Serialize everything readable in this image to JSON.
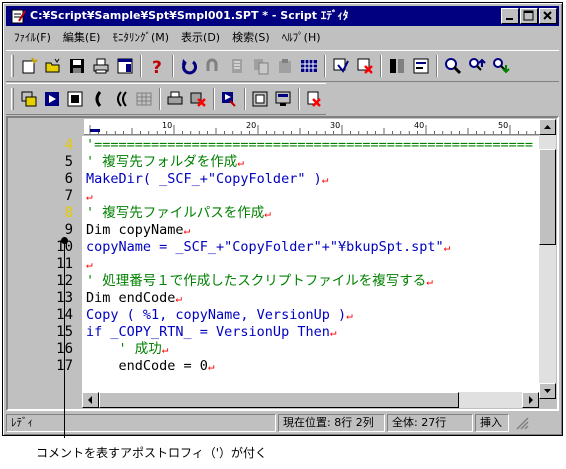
{
  "window": {
    "title": "C:¥Script¥Sample¥Spt¥Smpl001.SPT * - Script ｴﾃﾞｨﾀ"
  },
  "menu": [
    "ﾌｧｲﾙ(F)",
    "編集(E)",
    "ﾓﾆﾀﾘﾝｸﾞ(M)",
    "表示(D)",
    "検索(S)",
    "ﾍﾙﾌﾟ(H)"
  ],
  "toolbar1": [
    "new-file-icon",
    "open-icon",
    "save-icon",
    "print-icon",
    "properties-icon",
    "help-icon",
    "undo-icon",
    "redo-icon",
    "cut-icon",
    "copy-icon",
    "paste-icon",
    "grid-icon",
    "filter-icon",
    "delete-filter-icon",
    "format-icon",
    "settings-icon",
    "find-icon",
    "find-next-icon",
    "find-prev-icon"
  ],
  "toolbar2": [
    "monitor-icon",
    "run-icon",
    "stop-icon",
    "step-icon",
    "step-over-icon",
    "grid2-icon",
    "print2-icon",
    "delete-icon",
    "debug-icon",
    "window-icon",
    "window2-icon",
    "break-icon"
  ],
  "ruler": {
    "marks": [
      "10",
      "20",
      "30",
      "40",
      "50"
    ]
  },
  "lines": [
    {
      "num": "4",
      "text": "'======================================================",
      "cls": "cm",
      "eol": false,
      "current": false
    },
    {
      "num": "5",
      "text": "' 複写先フォルダを作成",
      "cls": "cm",
      "eol": true,
      "current": false
    },
    {
      "num": "6",
      "text": "MakeDir( _SCF_+\"CopyFolder\" )",
      "cls": "str",
      "eol": true,
      "current": false
    },
    {
      "num": "7",
      "text": "",
      "cls": "tx",
      "eol": true,
      "current": false
    },
    {
      "num": "8",
      "text": "' 複写先ファイルパスを作成",
      "cls": "cm",
      "eol": true,
      "current": true
    },
    {
      "num": "9",
      "text": "Dim copyName",
      "cls": "tx",
      "eol": true,
      "current": false
    },
    {
      "num": "10",
      "text": "copyName = _SCF_+\"CopyFolder\"+\"¥bkupSpt.spt\"",
      "cls": "str",
      "eol": true,
      "current": false
    },
    {
      "num": "11",
      "text": "",
      "cls": "tx",
      "eol": true,
      "current": false
    },
    {
      "num": "12",
      "text": "' 処理番号１で作成したスクリプトファイルを複写する",
      "cls": "cm",
      "eol": true,
      "current": false
    },
    {
      "num": "13",
      "text": "Dim endCode",
      "cls": "tx",
      "eol": true,
      "current": false
    },
    {
      "num": "14",
      "text": "Copy ( %1, copyName, VersionUp )",
      "cls": "kw",
      "eol": true,
      "current": false
    },
    {
      "num": "15",
      "text": "if _COPY_RTN_ = VersionUp Then",
      "cls": "kw",
      "eol": true,
      "current": false
    },
    {
      "num": "16",
      "text": "    ' 成功",
      "cls": "cm",
      "eol": true,
      "current": false
    },
    {
      "num": "17",
      "text": "    endCode = 0",
      "cls": "tx",
      "eol": true,
      "current": false
    }
  ],
  "status": {
    "ready": "ﾚﾃﾞｨ",
    "position": "現在位置:   8行  2列",
    "total": "全体:   27行",
    "mode": "挿入"
  },
  "callout": "コメントを表すアポストロフィ（'）が付く",
  "colors": {
    "title_bg": "#000080",
    "comment": "#008000",
    "keyword": "#0000c0",
    "eol": "#ff0000",
    "current_line_num": "#e8c800"
  }
}
